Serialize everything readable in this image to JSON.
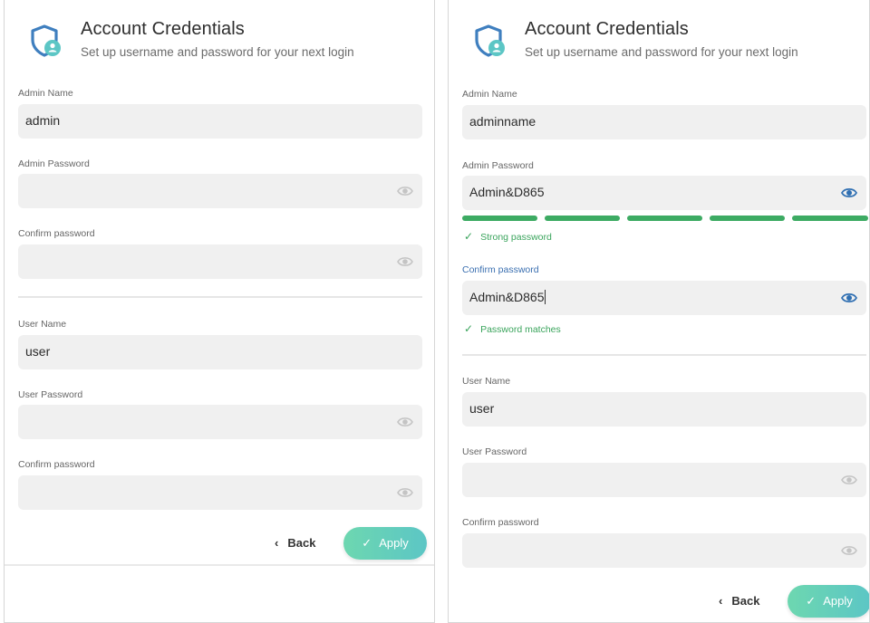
{
  "header": {
    "title": "Account Credentials",
    "subtitle": "Set up username and password for your next login",
    "logo_icon": "shield-user-icon"
  },
  "colors": {
    "accent_teal": "#5cc6c5",
    "logo_blue": "#4a8bc4",
    "strength_green": "#3dab63",
    "field_bg": "#f0f0f0"
  },
  "left": {
    "admin_name_label": "Admin Name",
    "admin_name_value": "admin",
    "admin_password_label": "Admin Password",
    "admin_password_value": "",
    "admin_confirm_label": "Confirm password",
    "admin_confirm_value": "",
    "user_name_label": "User Name",
    "user_name_value": "user",
    "user_password_label": "User Password",
    "user_password_value": "",
    "user_confirm_label": "Confirm password",
    "user_confirm_value": "",
    "back_label": "Back",
    "apply_label": "Apply"
  },
  "right": {
    "admin_name_label": "Admin Name",
    "admin_name_value": "adminname",
    "admin_password_label": "Admin Password",
    "admin_password_value": "Admin&D865",
    "strength_segments_filled": 5,
    "strength_segments_total": 5,
    "strength_text": "Strong password",
    "admin_confirm_label": "Confirm password",
    "admin_confirm_value": "Admin&D865",
    "match_text": "Password matches",
    "user_name_label": "User Name",
    "user_name_value": "user",
    "user_password_label": "User Password",
    "user_password_value": "",
    "user_confirm_label": "Confirm password",
    "user_confirm_value": "",
    "back_label": "Back",
    "apply_label": "Apply"
  }
}
